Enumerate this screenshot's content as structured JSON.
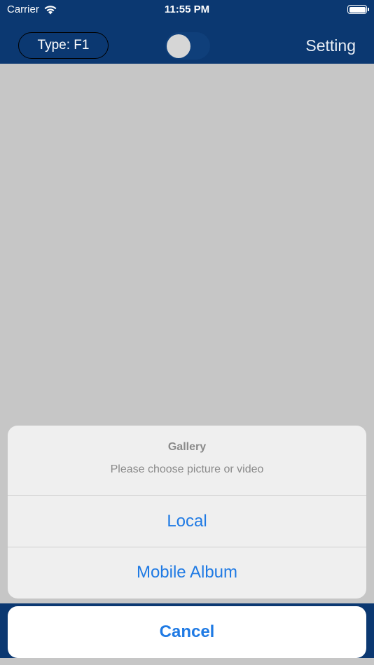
{
  "status_bar": {
    "carrier": "Carrier",
    "time": "11:55 PM",
    "icons": [
      "wifi-icon",
      "battery-icon"
    ]
  },
  "nav": {
    "type_label": "Type: F1",
    "toggle_on": false,
    "setting_label": "Setting"
  },
  "action_sheet": {
    "title": "Gallery",
    "message": "Please choose picture or video",
    "options": [
      {
        "label": "Local"
      },
      {
        "label": "Mobile Album"
      }
    ],
    "cancel_label": "Cancel"
  },
  "colors": {
    "nav_background": "#0b3871",
    "action_text": "#1f7ae4",
    "dimmed_background": "#c6c6c6"
  }
}
